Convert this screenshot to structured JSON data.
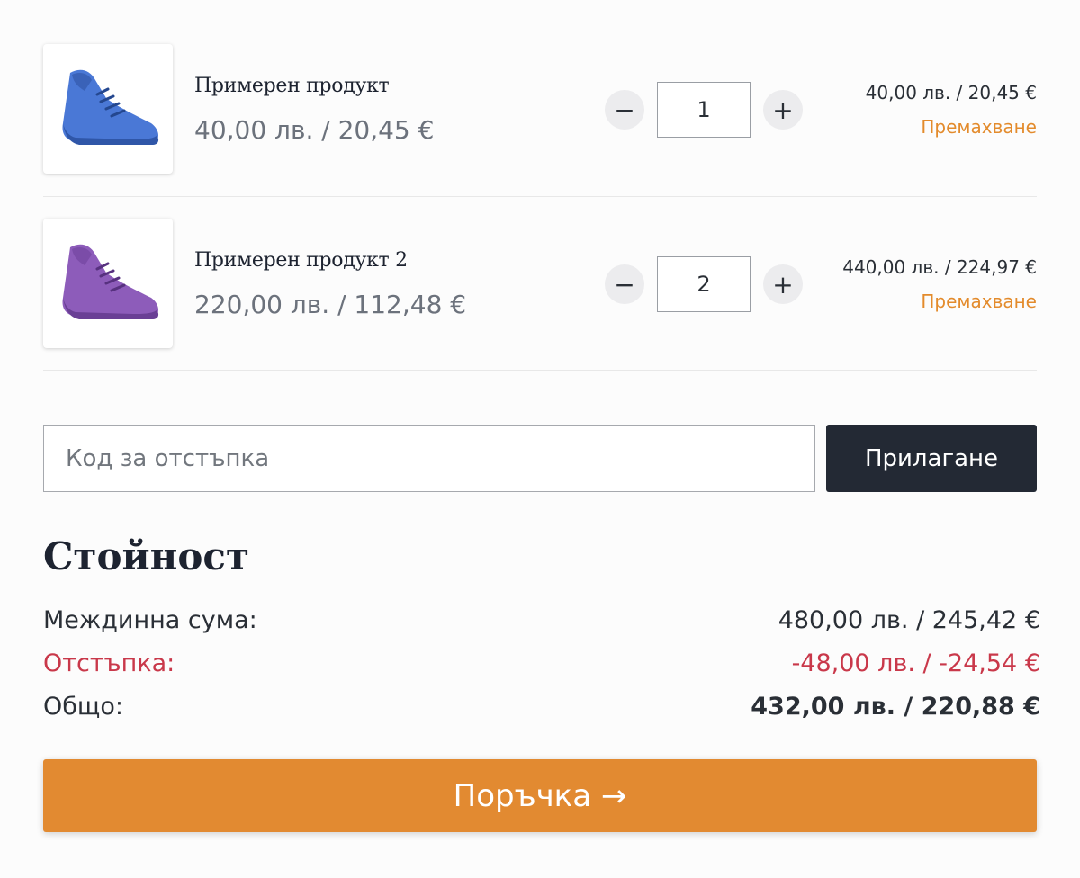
{
  "items": [
    {
      "name": "Примерен продукт",
      "unit_price": "40,00 лв. / 20,45 €",
      "quantity": "1",
      "line_total": "40,00 лв. / 20,45 €",
      "remove_label": "Премахване",
      "image_icon": "blue-sneaker-icon",
      "color": "#3f6fd1"
    },
    {
      "name": "Примерен продукт 2",
      "unit_price": "220,00 лв. / 112,48 €",
      "quantity": "2",
      "line_total": "440,00 лв. / 224,97 €",
      "remove_label": "Премахване",
      "image_icon": "purple-sneaker-icon",
      "color": "#8a5bb7"
    }
  ],
  "qty_controls": {
    "minus": "−",
    "plus": "+"
  },
  "coupon": {
    "placeholder": "Код за отстъпка",
    "apply_label": "Прилагане"
  },
  "summary": {
    "title": "Стойност",
    "subtotal_label": "Междинна сума:",
    "subtotal_value": "480,00 лв. /  245,42 €",
    "discount_label": "Отстъпка:",
    "discount_value": "-48,00 лв. / -24,54 €",
    "total_label": "Общо:",
    "total_value": "432,00 лв. / 220,88 €"
  },
  "checkout_label": "Поръчка →",
  "colors": {
    "accent": "#e28a31",
    "dark_button": "#232934",
    "discount": "#c9384a",
    "remove_link": "#e38b2c"
  }
}
